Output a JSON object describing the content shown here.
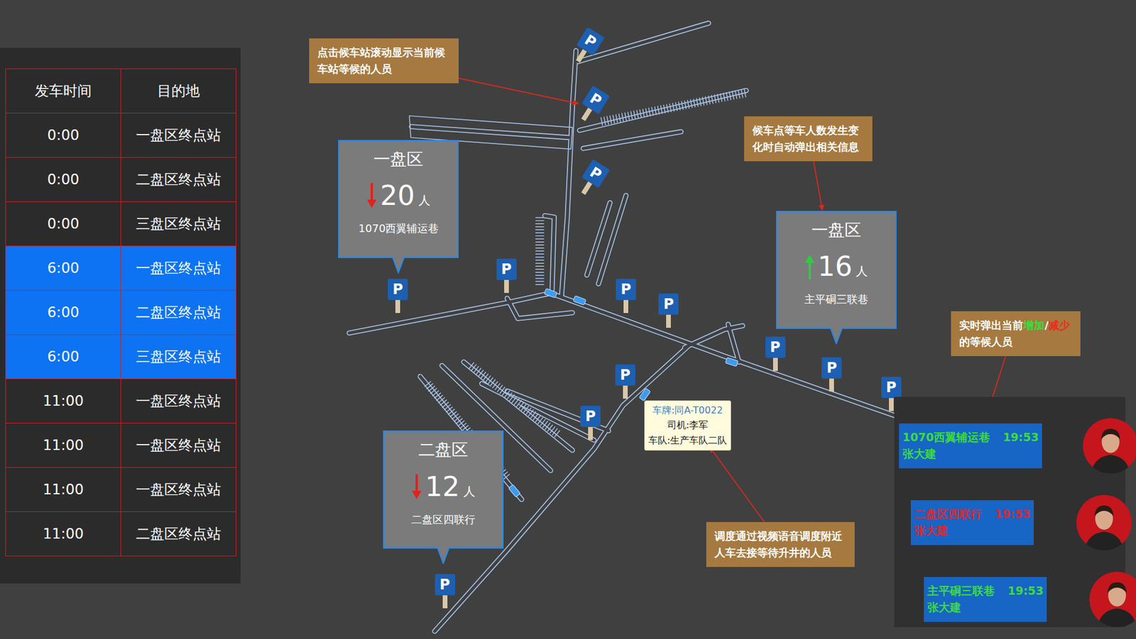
{
  "schedule": {
    "columns": [
      "发车时间",
      "目的地"
    ],
    "rows": [
      {
        "cells": [
          "0:00",
          "一盘区终点站"
        ],
        "selected": false
      },
      {
        "cells": [
          "0:00",
          "二盘区终点站"
        ],
        "selected": false
      },
      {
        "cells": [
          "0:00",
          "三盘区终点站"
        ],
        "selected": false
      },
      {
        "cells": [
          "6:00",
          "一盘区终点站"
        ],
        "selected": true
      },
      {
        "cells": [
          "6:00",
          "二盘区终点站"
        ],
        "selected": true
      },
      {
        "cells": [
          "6:00",
          "三盘区终点站"
        ],
        "selected": true
      },
      {
        "cells": [
          "11:00",
          "一盘区终点站"
        ],
        "selected": false
      },
      {
        "cells": [
          "11:00",
          "一盘区终点站"
        ],
        "selected": false
      },
      {
        "cells": [
          "11:00",
          "一盘区终点站"
        ],
        "selected": false
      },
      {
        "cells": [
          "11:00",
          "二盘区终点站"
        ],
        "selected": false
      }
    ]
  },
  "annotations": [
    {
      "segments": [
        {
          "text": "点击候车站滚动显示当前候车站等候的人员",
          "color": "#ffffff"
        }
      ]
    },
    {
      "segments": [
        {
          "text": "候车点等车人数发生变化时自动弹出相关信息",
          "color": "#ffffff"
        }
      ]
    },
    {
      "segments": [
        {
          "text": "实时弹出当前",
          "color": "#ffffff"
        },
        {
          "text": "增加",
          "color": "#3ddc3d"
        },
        {
          "text": "/",
          "color": "#ffffff"
        },
        {
          "text": "减少",
          "color": "#ec2a1e"
        },
        {
          "text": "的等候人员",
          "color": "#ffffff"
        }
      ]
    },
    {
      "segments": [
        {
          "text": "调度通过视频语音调度附近人车去接等待升井的人员",
          "color": "#ffffff"
        }
      ]
    }
  ],
  "stations": [
    {
      "area": "一盘区",
      "trend": "down",
      "count": "20",
      "unit": "人",
      "location": "1070西翼辅运巷"
    },
    {
      "area": "一盘区",
      "trend": "up",
      "count": "16",
      "unit": "人",
      "location": "主平硐三联巷"
    },
    {
      "area": "二盘区",
      "trend": "down",
      "count": "12",
      "unit": "人",
      "location": "二盘区四联行"
    }
  ],
  "parking_pins": [
    {
      "label": "P"
    },
    {
      "label": "P"
    },
    {
      "label": "P"
    },
    {
      "label": "P"
    },
    {
      "label": "P"
    },
    {
      "label": "P"
    },
    {
      "label": "P"
    },
    {
      "label": "P"
    },
    {
      "label": "P"
    },
    {
      "label": "P"
    },
    {
      "label": "P"
    },
    {
      "label": "P"
    },
    {
      "label": "P"
    }
  ],
  "vehicle": {
    "plate": "车牌:同A-T0022",
    "driver": "司机:李军",
    "fleet": "车队:生产车队二队"
  },
  "waiting_list": [
    {
      "location": "1070西翼辅运巷",
      "time": "19:53",
      "name": "张大建",
      "change": "increase",
      "color": "#3ddc3d"
    },
    {
      "location": "二盘区四联行",
      "time": "19:53",
      "name": "张大建",
      "change": "decrease",
      "color": "#e3262b"
    },
    {
      "location": "主平硐三联巷",
      "time": "19:53",
      "name": "张大建",
      "change": "increase",
      "color": "#3ddc3d"
    }
  ]
}
